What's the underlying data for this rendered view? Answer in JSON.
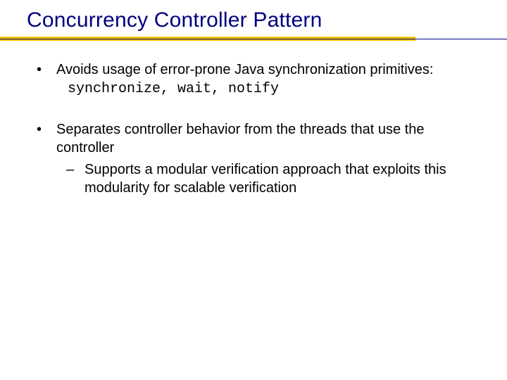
{
  "title": "Concurrency Controller Pattern",
  "bullets": [
    {
      "text": "Avoids usage of error-prone Java synchronization primitives:",
      "code": "synchronize, wait, notify"
    },
    {
      "text": "Separates controller behavior from the threads that use the controller",
      "sub": [
        "Supports a modular verification approach that exploits this modularity for scalable verification"
      ]
    }
  ]
}
